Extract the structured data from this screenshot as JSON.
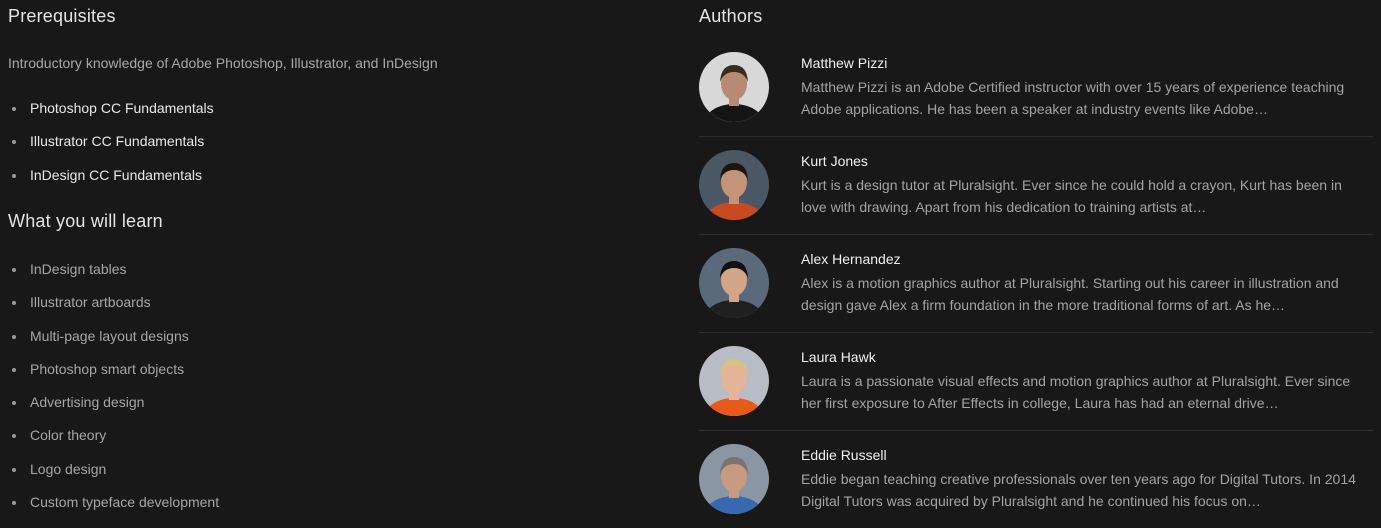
{
  "prerequisites": {
    "heading": "Prerequisites",
    "description": "Introductory knowledge of Adobe Photoshop, Illustrator, and InDesign",
    "courses": [
      "Photoshop CC Fundamentals",
      "Illustrator CC Fundamentals",
      "InDesign CC Fundamentals"
    ]
  },
  "learn": {
    "heading": "What you will learn",
    "items": [
      "InDesign tables",
      "Illustrator artboards",
      "Multi-page layout designs",
      "Photoshop smart objects",
      "Advertising design",
      "Color theory",
      "Logo design",
      "Custom typeface development"
    ]
  },
  "authors": {
    "heading": "Authors",
    "list": [
      {
        "name": "Matthew Pizzi",
        "bio": "Matthew Pizzi is an Adobe Certified instructor with over 15 years of experience teaching Adobe applications. He has been a speaker at industry events like Adobe…",
        "avatar_colors": {
          "bg": "#d8d8d8",
          "skin": "#b88a74",
          "hair": "#3a2a22",
          "shirt": "#151515"
        }
      },
      {
        "name": "Kurt Jones",
        "bio": "Kurt is a design tutor at Pluralsight. Ever since he could hold a crayon, Kurt has been in love with drawing. Apart from his dedication to training artists at…",
        "avatar_colors": {
          "bg": "#4a5866",
          "skin": "#c49478",
          "hair": "#1e1410",
          "shirt": "#c84a20"
        }
      },
      {
        "name": "Alex Hernandez",
        "bio": "Alex is a motion graphics author at Pluralsight. Starting out his career in illustration and design gave Alex a firm foundation in the more traditional forms of art. As he…",
        "avatar_colors": {
          "bg": "#5a6a7a",
          "skin": "#d2a488",
          "hair": "#141010",
          "shirt": "#202020"
        }
      },
      {
        "name": "Laura Hawk",
        "bio": "Laura is a passionate visual effects and motion graphics author at Pluralsight. Ever since her first exposure to After Effects in college, Laura has had an eternal drive…",
        "avatar_colors": {
          "bg": "#b8bcc4",
          "skin": "#e4b498",
          "hair": "#d8c088",
          "shirt": "#e85a1a"
        }
      },
      {
        "name": "Eddie Russell",
        "bio": "Eddie began teaching creative professionals over ten years ago for Digital Tutors. In 2014 Digital Tutors was acquired by Pluralsight and he continued his focus on…",
        "avatar_colors": {
          "bg": "#8a96a4",
          "skin": "#c89a80",
          "hair": "#7a7470",
          "shirt": "#3868b0"
        }
      }
    ]
  }
}
